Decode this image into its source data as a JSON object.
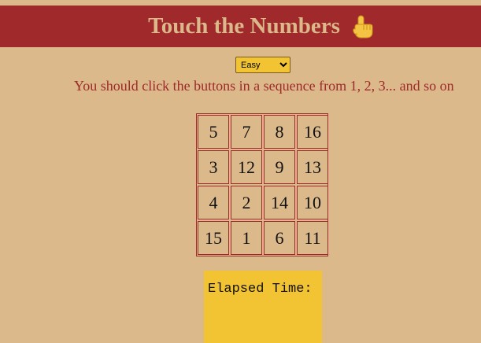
{
  "header": {
    "title": "Touch the Numbers",
    "icon": "pointing-hand-icon",
    "background": "#a0292c",
    "title_color": "#dbb98a"
  },
  "difficulty": {
    "selected": "Easy"
  },
  "instructions": "You should click the buttons in a sequence from 1, 2, 3... and so on",
  "board": {
    "cells": [
      "5",
      "7",
      "8",
      "16",
      "3",
      "12",
      "9",
      "13",
      "4",
      "2",
      "14",
      "10",
      "15",
      "1",
      "6",
      "11"
    ],
    "border_color": "#a0292c"
  },
  "timer": {
    "label": "Elapsed Time:",
    "background": "#f2c332"
  },
  "page": {
    "background": "#dbb98a"
  }
}
